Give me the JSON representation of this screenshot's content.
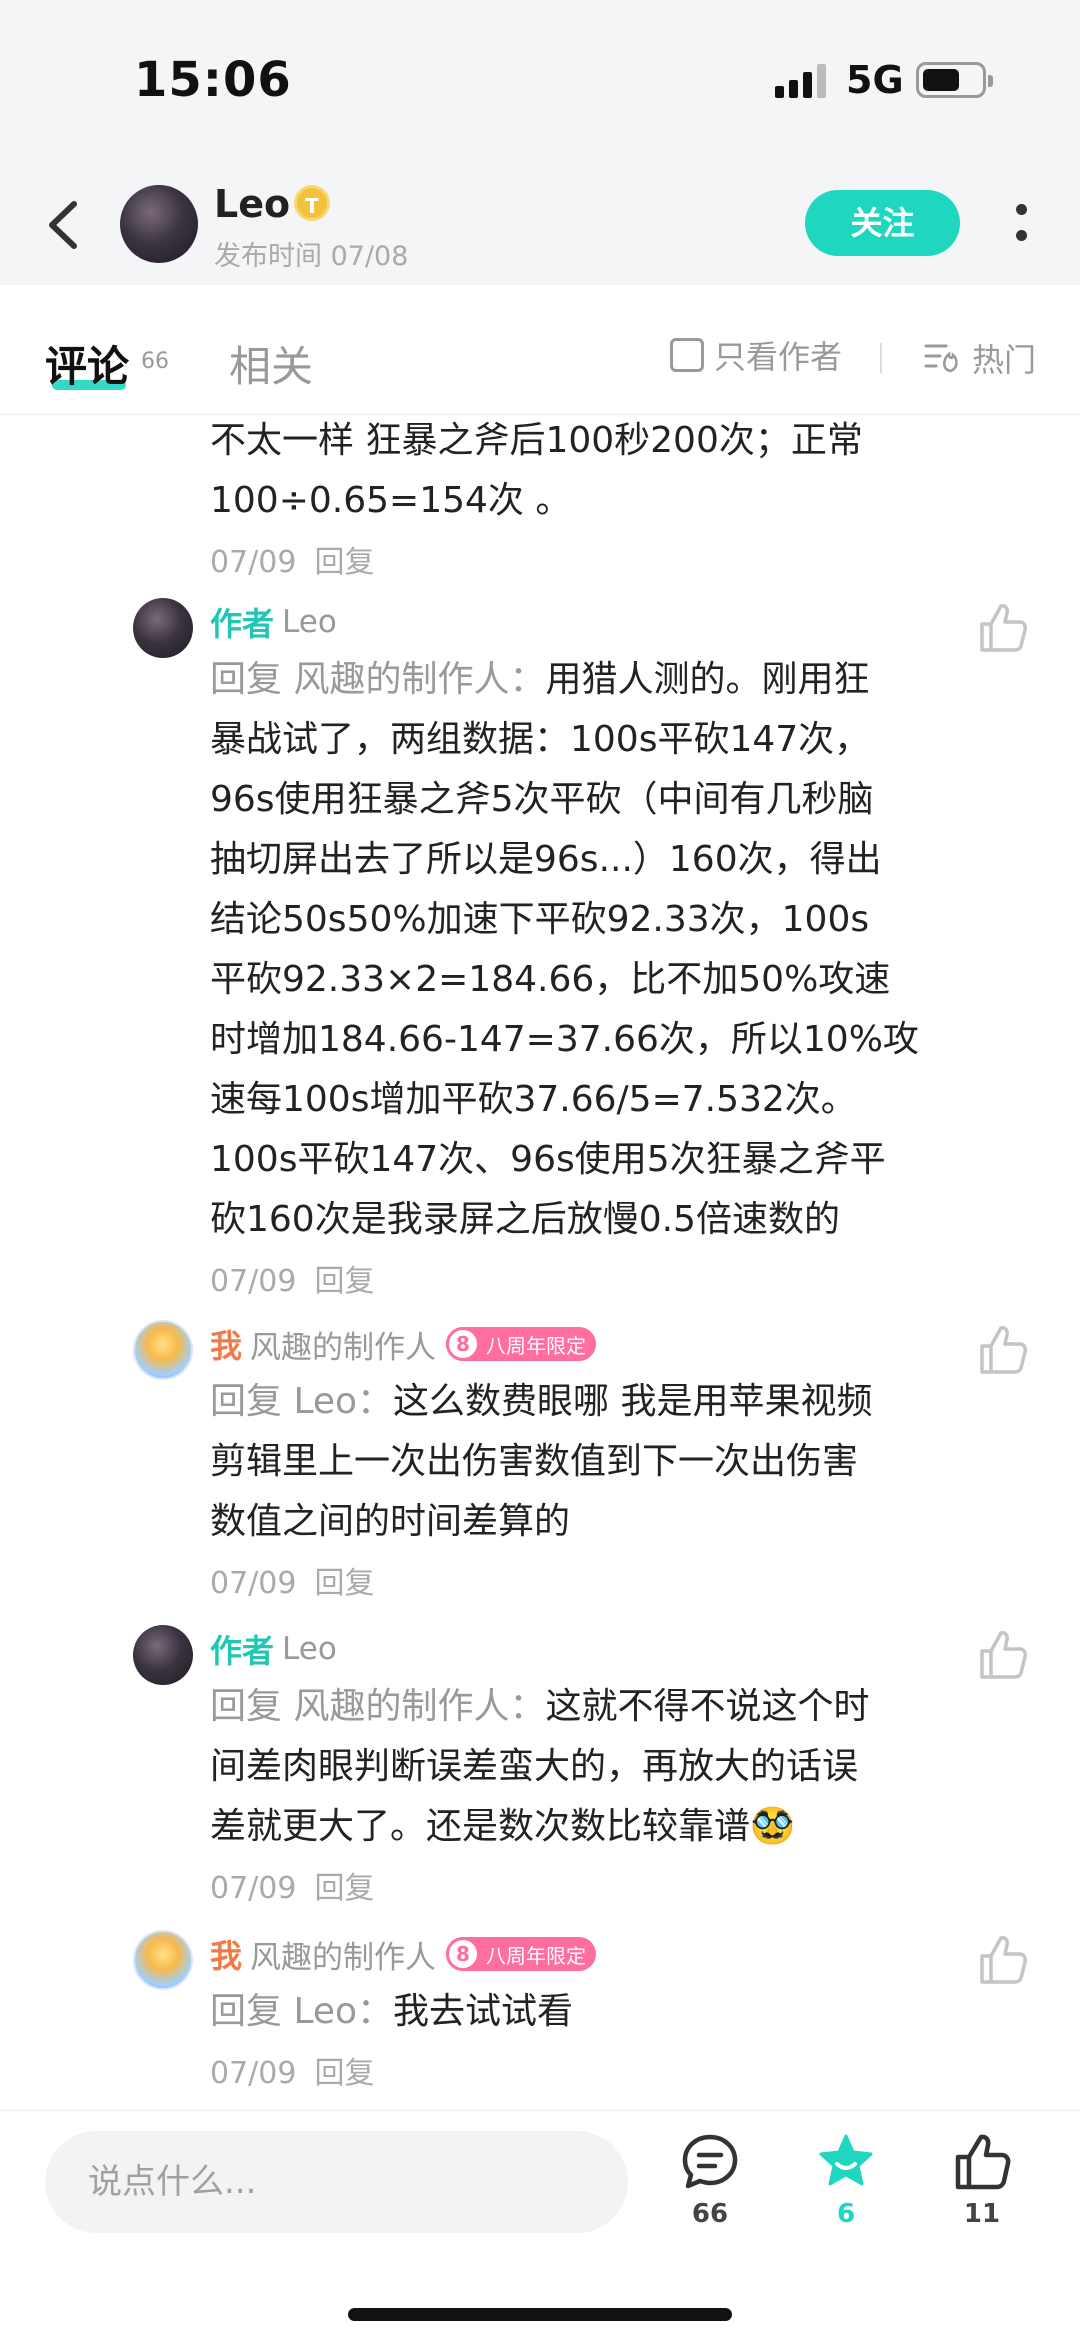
{
  "status_bar": {
    "time": "15:06",
    "network": "5G"
  },
  "header": {
    "author_name": "Leo",
    "author_badge": "T",
    "publish_time": "发布时间 07/08",
    "follow_label": "关注"
  },
  "tabs": {
    "comments_label": "评论",
    "comments_count": "66",
    "related_label": "相关",
    "author_only_label": "只看作者",
    "sort_label": "热门"
  },
  "comments": [
    {
      "text_lines": [
        "不太一样 狂暴之斧后100秒200次；正常",
        "100÷0.65=154次 。"
      ],
      "date": "07/09",
      "reply_label": "回复"
    },
    {
      "role": "作者",
      "name": "Leo",
      "reply_prefix": "回复 风趣的制作人：",
      "text_lines": [
        "用猎人测的。刚用狂",
        "暴战试了，两组数据：100s平砍147次，",
        "96s使用狂暴之斧5次平砍（中间有几秒脑",
        "抽切屏出去了所以是96s...）160次，得出",
        "结论50s50%加速下平砍92.33次，100s",
        "平砍92.33×2=184.66，比不加50%攻速",
        "时增加184.66-147=37.66次，所以10%攻",
        "速每100s增加平砍37.66/5=7.532次。",
        "100s平砍147次、96s使用5次狂暴之斧平",
        "砍160次是我录屏之后放慢0.5倍速数的"
      ],
      "date": "07/09",
      "reply_label": "回复"
    },
    {
      "role": "我",
      "name": "风趣的制作人",
      "badge_num": "8",
      "badge_label": "八周年限定",
      "reply_prefix": "回复 Leo：",
      "text_lines": [
        "这么数费眼哪 我是用苹果视频",
        "剪辑里上一次出伤害数值到下一次出伤害",
        "数值之间的时间差算的"
      ],
      "date": "07/09",
      "reply_label": "回复"
    },
    {
      "role": "作者",
      "name": "Leo",
      "reply_prefix": "回复 风趣的制作人：",
      "text_lines": [
        "这就不得不说这个时",
        "间差肉眼判断误差蛮大的，再放大的话误",
        "差就更大了。还是数次数比较靠谱"
      ],
      "emoji": "🥸",
      "date": "07/09",
      "reply_label": "回复"
    },
    {
      "role": "我",
      "name": "风趣的制作人",
      "badge_num": "8",
      "badge_label": "八周年限定",
      "reply_prefix": "回复 Leo：",
      "text_lines": [
        "我去试试看"
      ],
      "date": "07/09",
      "reply_label": "回复"
    }
  ],
  "bottom_bar": {
    "input_placeholder": "说点什么...",
    "comment_count": "66",
    "favorite_count": "6",
    "like_count": "11"
  },
  "colors": {
    "accent": "#1fd6c1",
    "author_role": "#1fc7b4",
    "me_role": "#f07b4a",
    "badge_pink": "#ff6e9e"
  },
  "icons": [
    "back-icon",
    "coin-badge-icon",
    "more-icon",
    "checkbox-icon",
    "hot-sort-icon",
    "thumbs-up-icon",
    "comment-icon",
    "star-icon"
  ]
}
